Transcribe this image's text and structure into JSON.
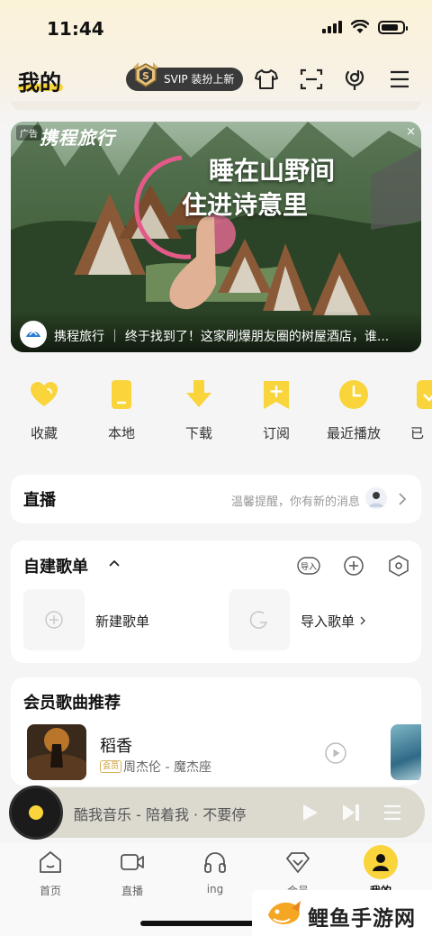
{
  "status_bar": {
    "time": "11:44"
  },
  "header": {
    "title": "我的",
    "svip_label": "SVIP 装扮上新",
    "icons": [
      "tshirt-icon",
      "scan-icon",
      "mic-search-icon",
      "menu-icon"
    ]
  },
  "ad": {
    "tag": "广告",
    "brand": "携程旅行",
    "headline_1": "睡在山野间",
    "headline_2": "住进诗意里",
    "caption": "携程旅行 ｜ 终于找到了！这家刷爆朋友圈的树屋酒店，谁...",
    "close": "×"
  },
  "quick_actions": [
    {
      "label": "收藏",
      "icon": "heart-icon"
    },
    {
      "label": "本地",
      "icon": "phone-icon"
    },
    {
      "label": "下载",
      "icon": "download-icon"
    },
    {
      "label": "订阅",
      "icon": "subscribe-icon"
    },
    {
      "label": "最近播放",
      "icon": "clock-icon"
    },
    {
      "label": "已",
      "icon": "check-icon"
    }
  ],
  "live": {
    "title": "直播",
    "hint": "温馨提醒，你有新的消息"
  },
  "playlists": {
    "title": "自建歌单",
    "import_icon_text": "导入",
    "new_label": "新建歌单",
    "import_label": "导入歌单"
  },
  "vip_songs": {
    "title": "会员歌曲推荐",
    "song": {
      "title": "稻香",
      "badge": "会员",
      "meta": "周杰伦 - 魔杰座"
    }
  },
  "player": {
    "text": "酷我音乐 - 陪着我 · 不要停"
  },
  "tabs": [
    {
      "label": "首页",
      "icon": "home-icon"
    },
    {
      "label": "直播",
      "icon": "video-icon"
    },
    {
      "label": "ing",
      "icon": "headphones-icon"
    },
    {
      "label": "会员",
      "icon": "diamond-icon"
    },
    {
      "label": "我的",
      "icon": "profile-icon",
      "active": true
    }
  ],
  "watermark": {
    "text": "鲤鱼手游网"
  },
  "colors": {
    "accent": "#f9d43a",
    "background": "#f5f5f5"
  }
}
